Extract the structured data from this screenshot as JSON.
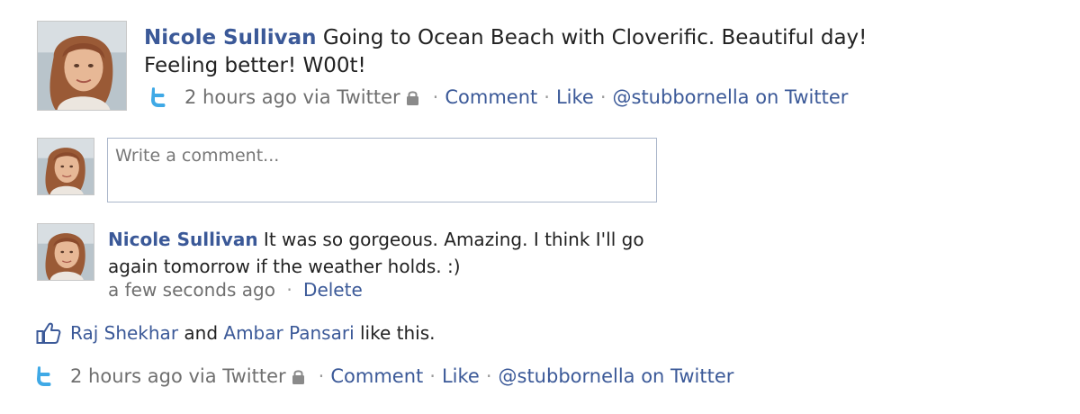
{
  "post": {
    "author": "Nicole Sullivan",
    "text": " Going to Ocean Beach with Cloverific. Beautiful day! Feeling better! W00t!",
    "meta": {
      "time": "2 hours ago via Twitter",
      "comment": "Comment",
      "like": "Like",
      "twitter_link": "@stubbornella on Twitter",
      "separator": "·"
    }
  },
  "composer": {
    "placeholder": "Write a comment..."
  },
  "comment": {
    "author": "Nicole Sullivan",
    "text": " It was so gorgeous. Amazing. I think I'll go again tomorrow if the weather holds. :)",
    "time": "a few seconds ago",
    "delete": "Delete",
    "separator": "·"
  },
  "likes": {
    "user1": "Raj Shekhar",
    "and": " and ",
    "user2": "Ambar Pansari",
    "suffix": " like this."
  },
  "footer_meta": {
    "time": "2 hours ago via Twitter",
    "comment": "Comment",
    "like": "Like",
    "twitter_link": "@stubbornella on Twitter",
    "separator": "·"
  },
  "colors": {
    "link": "#3b5998",
    "muted": "#6f6f6f",
    "twitter_blue": "#3fa9e6",
    "input_border": "#aab6ca"
  },
  "icons": {
    "twitter": "twitter-icon",
    "lock": "lock-icon",
    "thumbs_up": "thumbs-up-icon"
  }
}
